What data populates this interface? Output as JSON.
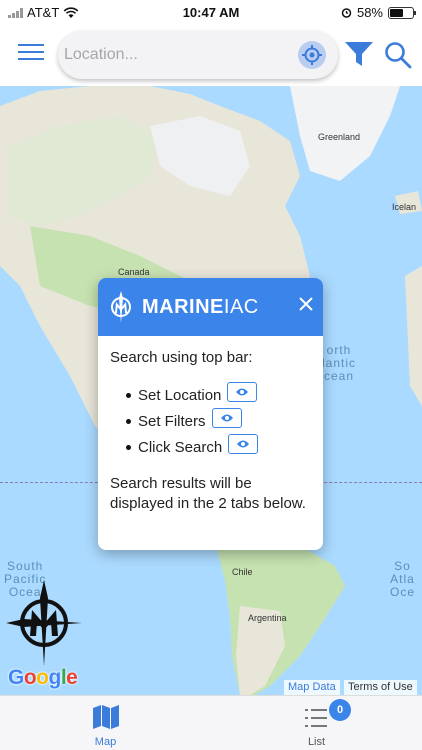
{
  "status_bar": {
    "carrier": "AT&T",
    "time": "10:47 AM",
    "battery": "58%",
    "battery_level": 0.58,
    "icons": [
      "signal-icon",
      "wifi-icon",
      "alarm-icon",
      "battery-icon"
    ]
  },
  "top_bar": {
    "location_placeholder": "Location...",
    "location_value": "",
    "icons": [
      "menu-icon",
      "crosshair-icon",
      "filter-icon",
      "search-icon"
    ]
  },
  "map": {
    "labels": {
      "greenland": "Greenland",
      "iceland": "Icelan",
      "canada": "Canada",
      "chile": "Chile",
      "argentina": "Argentina"
    },
    "oceans": {
      "north_atlantic_1": "orth",
      "north_atlantic_2": "lantic",
      "north_atlantic_3": "cean",
      "south_pacific_1": "South",
      "south_pacific_2": "Pacific",
      "south_pacific_3": "Ocea",
      "south_atlantic_1": "So",
      "south_atlantic_2": "Atla",
      "south_atlantic_3": "Oce"
    },
    "google": "Google",
    "map_data": "Map Data",
    "terms": "Terms of Use"
  },
  "dialog": {
    "brand_bold": "MARINE",
    "brand_thin": "IAC",
    "intro": "Search using top bar:",
    "items": [
      "Set Location",
      "Set Filters",
      "Click Search"
    ],
    "footer": "Search results will be displayed in the 2 tabs below."
  },
  "tabs": {
    "map_label": "Map",
    "list_label": "List",
    "list_badge": "0"
  },
  "colors": {
    "accent": "#3a84ea",
    "water": "#aadaff",
    "land": "#e8e6d9",
    "vegetation": "#c6e2b1"
  }
}
